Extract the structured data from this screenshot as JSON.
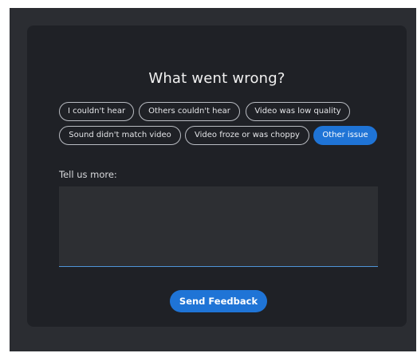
{
  "dialog": {
    "title": "What went wrong?",
    "options": [
      {
        "label": "I couldn't hear",
        "selected": false
      },
      {
        "label": "Others couldn't hear",
        "selected": false
      },
      {
        "label": "Video was low quality",
        "selected": false
      },
      {
        "label": "Sound didn't match video",
        "selected": false
      },
      {
        "label": "Video froze or was choppy",
        "selected": false
      },
      {
        "label": "Other issue",
        "selected": true
      }
    ],
    "details_label": "Tell us more:",
    "details_value": "",
    "submit_label": "Send Feedback"
  },
  "colors": {
    "accent": "#1f74d6",
    "card_background": "#1f2126",
    "page_background": "#2b2d32",
    "chip_border": "#b9bcc2"
  }
}
